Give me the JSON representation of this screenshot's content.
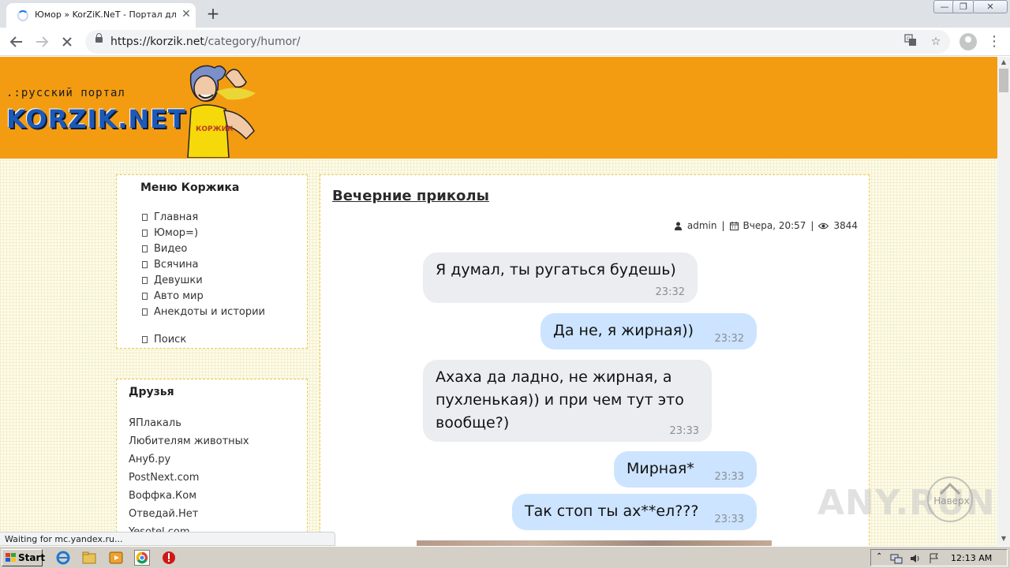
{
  "browser": {
    "tab_title": "Юмор » KorZiK.NeT - Портал для ру",
    "tab_close": "✕",
    "new_tab": "+",
    "url_host": "https://korzik.net",
    "url_path": "/category/humor/",
    "status_text": "Waiting for mc.yandex.ru...",
    "window_buttons": [
      "—",
      "❐",
      "✕"
    ]
  },
  "site": {
    "logo_sub": ".:русский портал",
    "logo_main": "KORZIK.NET",
    "menu_title": "Меню Коржика",
    "menu_items": [
      "Главная",
      "Юмор=)",
      "Видео",
      "Всячина",
      "Девушки",
      "Авто мир",
      "Анекдоты и истории",
      "Поиск"
    ],
    "friends_title": "Друзья",
    "friends": [
      "ЯПлакаль",
      "Любителям животных",
      "Ануб.ру",
      "PostNext.com",
      "Воффка.Ком",
      "Отведай.Нет",
      "Yesotel.com"
    ]
  },
  "post": {
    "title": "Вечерние приколы",
    "author": "admin",
    "date": "Вчера, 20:57",
    "views": "3844",
    "messages": [
      {
        "text": "Я думал, ты ругаться будешь)",
        "time": "23:32",
        "side": "in"
      },
      {
        "text": "Да не, я жирная))",
        "time": "23:32",
        "side": "out"
      },
      {
        "text": "Ахаха да ладно, не жирная, а пухленькая)) и при чем тут это вообще?)",
        "time": "23:33",
        "side": "in"
      },
      {
        "text": "Мирная*",
        "time": "23:33",
        "side": "out"
      },
      {
        "text": "Так стоп ты ах**ел???",
        "time": "23:33",
        "side": "out"
      }
    ]
  },
  "scroll_up_label": "Наверх",
  "watermark": "ANY.RUN",
  "taskbar": {
    "start_label": "Start",
    "clock": "12:13 AM"
  },
  "colors": {
    "header_orange": "#f39c12",
    "bubble_in": "#ebedf0",
    "bubble_out": "#cce4ff"
  }
}
